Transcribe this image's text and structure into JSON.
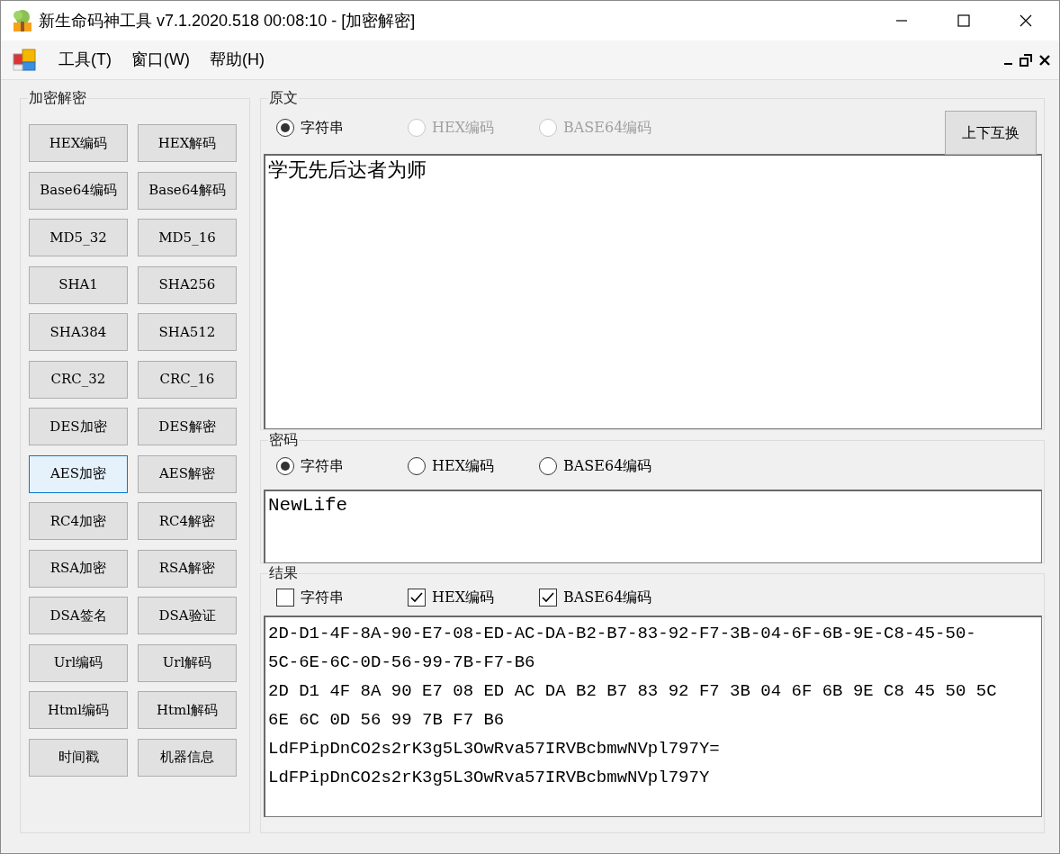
{
  "window": {
    "title": "新生命码神工具 v7.1.2020.518 00:08:10 - [加密解密]"
  },
  "menu": [
    "工具(T)",
    "窗口(W)",
    "帮助(H)"
  ],
  "tools": {
    "title": "加密解密",
    "buttons": [
      {
        "label": "HEX编码",
        "selected": false
      },
      {
        "label": "HEX解码",
        "selected": false
      },
      {
        "label": "Base64编码",
        "selected": false
      },
      {
        "label": "Base64解码",
        "selected": false
      },
      {
        "label": "MD5_32",
        "selected": false
      },
      {
        "label": "MD5_16",
        "selected": false
      },
      {
        "label": "SHA1",
        "selected": false
      },
      {
        "label": "SHA256",
        "selected": false
      },
      {
        "label": "SHA384",
        "selected": false
      },
      {
        "label": "SHA512",
        "selected": false
      },
      {
        "label": "CRC_32",
        "selected": false
      },
      {
        "label": "CRC_16",
        "selected": false
      },
      {
        "label": "DES加密",
        "selected": false
      },
      {
        "label": "DES解密",
        "selected": false
      },
      {
        "label": "AES加密",
        "selected": true
      },
      {
        "label": "AES解密",
        "selected": false
      },
      {
        "label": "RC4加密",
        "selected": false
      },
      {
        "label": "RC4解密",
        "selected": false
      },
      {
        "label": "RSA加密",
        "selected": false
      },
      {
        "label": "RSA解密",
        "selected": false
      },
      {
        "label": "DSA签名",
        "selected": false
      },
      {
        "label": "DSA验证",
        "selected": false
      },
      {
        "label": "Url编码",
        "selected": false
      },
      {
        "label": "Url解码",
        "selected": false
      },
      {
        "label": "Html编码",
        "selected": false
      },
      {
        "label": "Html解码",
        "selected": false
      },
      {
        "label": "时间戳",
        "selected": false
      },
      {
        "label": "机器信息",
        "selected": false
      }
    ]
  },
  "source": {
    "title": "原文",
    "options": [
      {
        "label": "字符串",
        "selected": true,
        "disabled": false
      },
      {
        "label": "HEX编码",
        "selected": false,
        "disabled": true
      },
      {
        "label": "BASE64编码",
        "selected": false,
        "disabled": true
      }
    ],
    "swap_button": "上下互换",
    "value": "学无先后达者为师"
  },
  "password": {
    "title": "密码",
    "options": [
      {
        "label": "字符串",
        "selected": true,
        "disabled": false
      },
      {
        "label": "HEX编码",
        "selected": false,
        "disabled": false
      },
      {
        "label": "BASE64编码",
        "selected": false,
        "disabled": false
      }
    ],
    "value": "NewLife"
  },
  "result": {
    "title": "结果",
    "options": [
      {
        "label": "字符串",
        "checked": false
      },
      {
        "label": "HEX编码",
        "checked": true
      },
      {
        "label": "BASE64编码",
        "checked": true
      }
    ],
    "lines": [
      "2D-D1-4F-8A-90-E7-08-ED-AC-DA-B2-B7-83-92-F7-3B-04-6F-6B-9E-C8-45-50-",
      "5C-6E-6C-0D-56-99-7B-F7-B6",
      "2D D1 4F 8A 90 E7 08 ED AC DA B2 B7 83 92 F7 3B 04 6F 6B 9E C8 45 50 5C",
      "6E 6C 0D 56 99 7B F7 B6",
      "LdFPipDnCO2s2rK3g5L3OwRva57IRVBcbmwNVpl797Y=",
      "LdFPipDnCO2s2rK3g5L3OwRva57IRVBcbmwNVpl797Y"
    ]
  }
}
